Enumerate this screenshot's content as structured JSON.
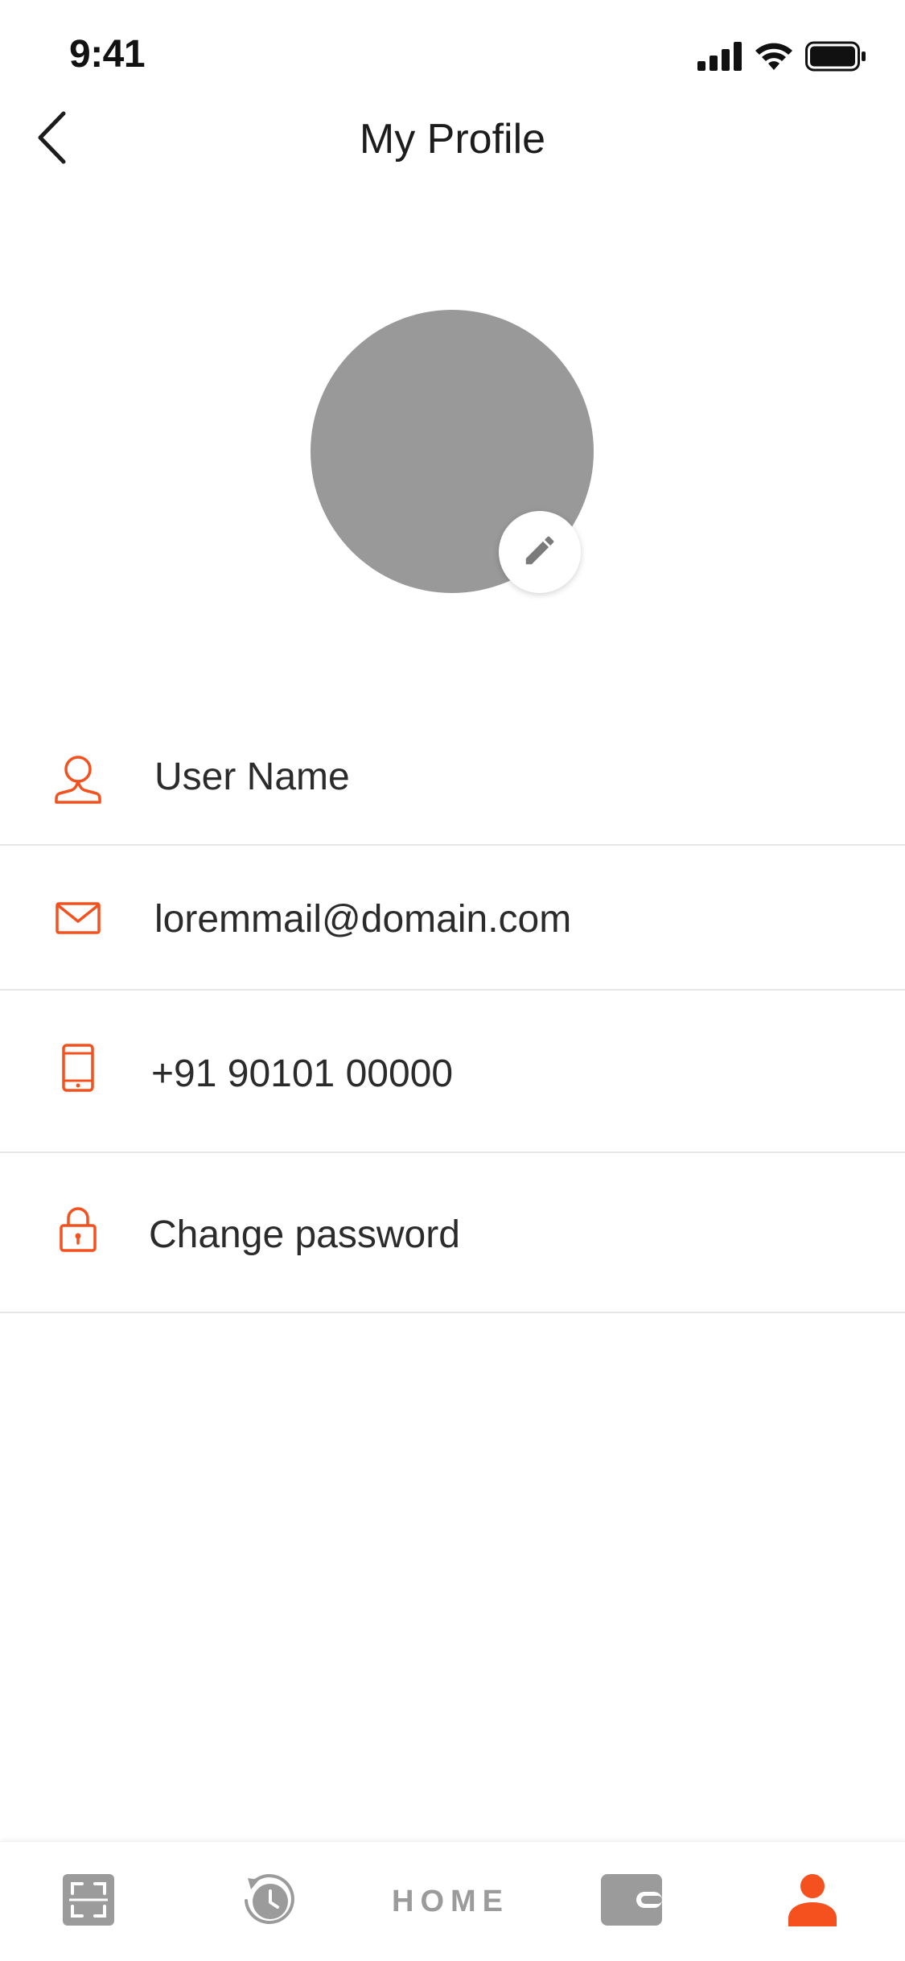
{
  "status_bar": {
    "time": "9:41",
    "icons": [
      "cellular-signal-icon",
      "wifi-icon",
      "battery-icon"
    ]
  },
  "header": {
    "title": "My Profile",
    "back_icon": "chevron-left-icon"
  },
  "avatar": {
    "edit_icon": "pencil-icon"
  },
  "profile_rows": [
    {
      "icon": "user-icon",
      "label": "User Name"
    },
    {
      "icon": "mail-icon",
      "label": "loremmail@domain.com"
    },
    {
      "icon": "phone-icon",
      "label": "+91 90101 00000"
    },
    {
      "icon": "lock-icon",
      "label": "Change password"
    }
  ],
  "tab_bar": {
    "items": [
      {
        "icon": "scan-icon",
        "label": ""
      },
      {
        "icon": "history-icon",
        "label": ""
      },
      {
        "icon": "",
        "label": "HOME"
      },
      {
        "icon": "wallet-icon",
        "label": ""
      },
      {
        "icon": "profile-icon",
        "label": "",
        "active": true
      }
    ]
  },
  "colors": {
    "accent": "#f4511e",
    "inactive_icon": "#9b9b9b",
    "avatar_placeholder": "#999999",
    "divider": "#e6e6e6"
  }
}
